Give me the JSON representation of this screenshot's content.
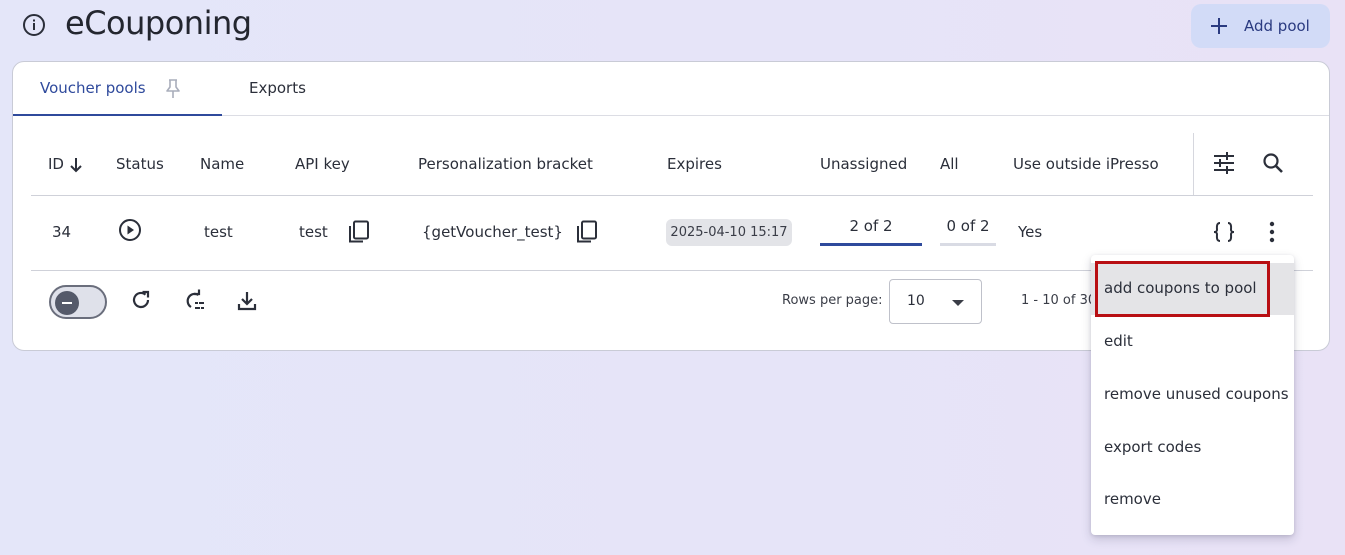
{
  "header": {
    "title": "eCouponing",
    "add_pool_label": "Add pool"
  },
  "tabs": [
    {
      "label": "Voucher pools",
      "active": true,
      "pinned": true
    },
    {
      "label": "Exports",
      "active": false
    }
  ],
  "table": {
    "columns": [
      "ID",
      "Status",
      "Name",
      "API key",
      "Personalization bracket",
      "Expires",
      "Unassigned",
      "All",
      "Use outside iPresso"
    ],
    "sort_column": "ID",
    "sort_direction": "descending",
    "rows": [
      {
        "id": "34",
        "status": "play-circle-icon",
        "name": "test",
        "api_key": "test",
        "bracket": "{getVoucher_test}",
        "expires": "2025-04-10 15:17",
        "unassigned": "2 of 2",
        "unassigned_fraction": 1.0,
        "all": "0 of 2",
        "all_fraction": 0.0,
        "use_outside": "Yes"
      }
    ]
  },
  "footer": {
    "rows_per_page_label": "Rows per page:",
    "rows_per_page_value": "10",
    "pagination": "1 - 10 of 30"
  },
  "context_menu": {
    "items": [
      "add coupons to pool",
      "edit",
      "remove unused coupons",
      "export codes",
      "remove"
    ],
    "highlighted_index": 0
  },
  "colors": {
    "accent": "#2f4a9c",
    "add_button_bg": "#d2dbf7",
    "highlight_border": "#b80f13"
  }
}
